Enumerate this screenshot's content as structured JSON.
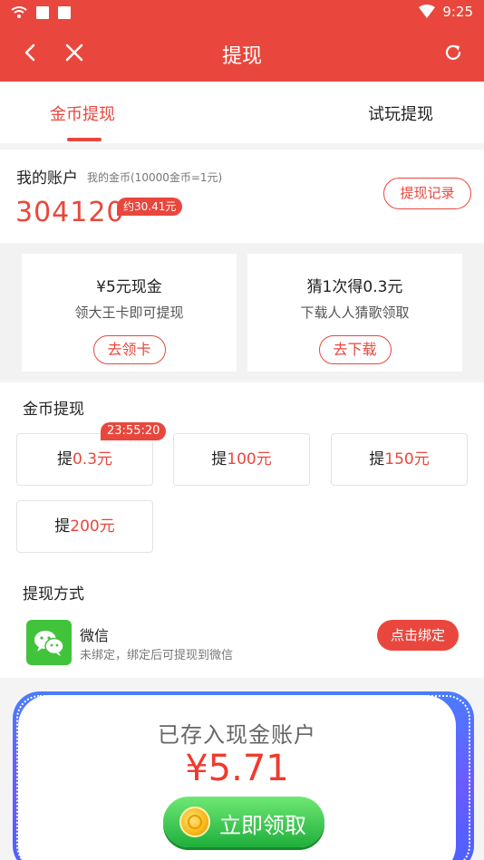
{
  "status_bar": {
    "time": "9:25"
  },
  "nav": {
    "title": "提现"
  },
  "tabs": [
    {
      "label": "金币提现"
    },
    {
      "label": "试玩提现"
    }
  ],
  "account": {
    "title": "我的账户",
    "subtitle": "我的金币(10000金币=1元)",
    "balance": "304120",
    "badge": "约30.41元",
    "record_button": "提现记录"
  },
  "promos": [
    {
      "title": "¥5元现金",
      "subtitle": "领大王卡即可提现",
      "button": "去领卡"
    },
    {
      "title": "猜1次得0.3元",
      "subtitle": "下载人人猜歌领取",
      "button": "去下载"
    }
  ],
  "withdraw": {
    "section_title": "金币提现",
    "timer": "23:55:20",
    "prefix": "提",
    "options": [
      {
        "value": "0.3元"
      },
      {
        "value": "100元"
      },
      {
        "value": "150元"
      },
      {
        "value": "200元"
      }
    ]
  },
  "payment": {
    "section_title": "提现方式",
    "name": "微信",
    "description": "未绑定，绑定后可提现到微信",
    "bind_button": "点击绑定"
  },
  "cash": {
    "title": "已存入现金账户",
    "amount": "¥5.71",
    "claim_button": "立即领取"
  },
  "colors": {
    "accent": "#e9473d",
    "wechat": "#41c33c",
    "claim": "#1fae3b",
    "frame": "#4a7cff"
  },
  "icons": [
    "wifi-icon",
    "notification-icon",
    "signal-icon",
    "back-icon",
    "close-icon",
    "refresh-icon",
    "wechat-icon",
    "coin-icon"
  ]
}
